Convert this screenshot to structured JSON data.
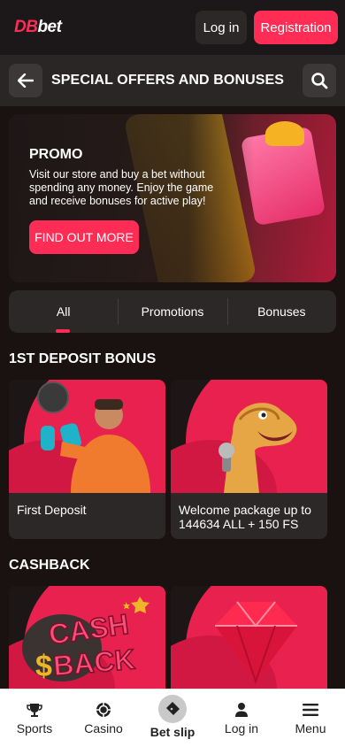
{
  "header": {
    "logo_db": "DB",
    "logo_bet": "bet",
    "login_label": "Log in",
    "registration_label": "Registration"
  },
  "titlebar": {
    "title": "SPECIAL OFFERS AND BONUSES",
    "back_icon": "arrow-left-icon",
    "search_icon": "search-icon"
  },
  "banner": {
    "title": "PROMO",
    "text": "Visit our store and buy a bet without spending any money. Enjoy the game and receive bonuses for active play!",
    "button_label": "FIND OUT MORE"
  },
  "tabs": [
    {
      "label": "All",
      "active": true
    },
    {
      "label": "Promotions",
      "active": false
    },
    {
      "label": "Bonuses",
      "active": false
    }
  ],
  "sections": {
    "first_deposit": {
      "title": "1ST DEPOSIT BONUS",
      "cards": [
        {
          "caption": "First Deposit"
        },
        {
          "caption": "Welcome package up to 144634 ALL + 150 FS"
        }
      ]
    },
    "cashback": {
      "title": "CASHBACK",
      "card_image_text_1": "CASH",
      "card_image_text_2": "BACK"
    }
  },
  "bottom_nav": [
    {
      "label": "Sports",
      "icon": "trophy-icon"
    },
    {
      "label": "Casino",
      "icon": "chip-icon"
    },
    {
      "label": "Bet slip",
      "icon": "ticket-icon"
    },
    {
      "label": "Log in",
      "icon": "user-icon"
    },
    {
      "label": "Menu",
      "icon": "menu-icon"
    }
  ],
  "colors": {
    "accent": "#ff2d55",
    "background": "#1a1111",
    "surface": "#2c2828"
  }
}
